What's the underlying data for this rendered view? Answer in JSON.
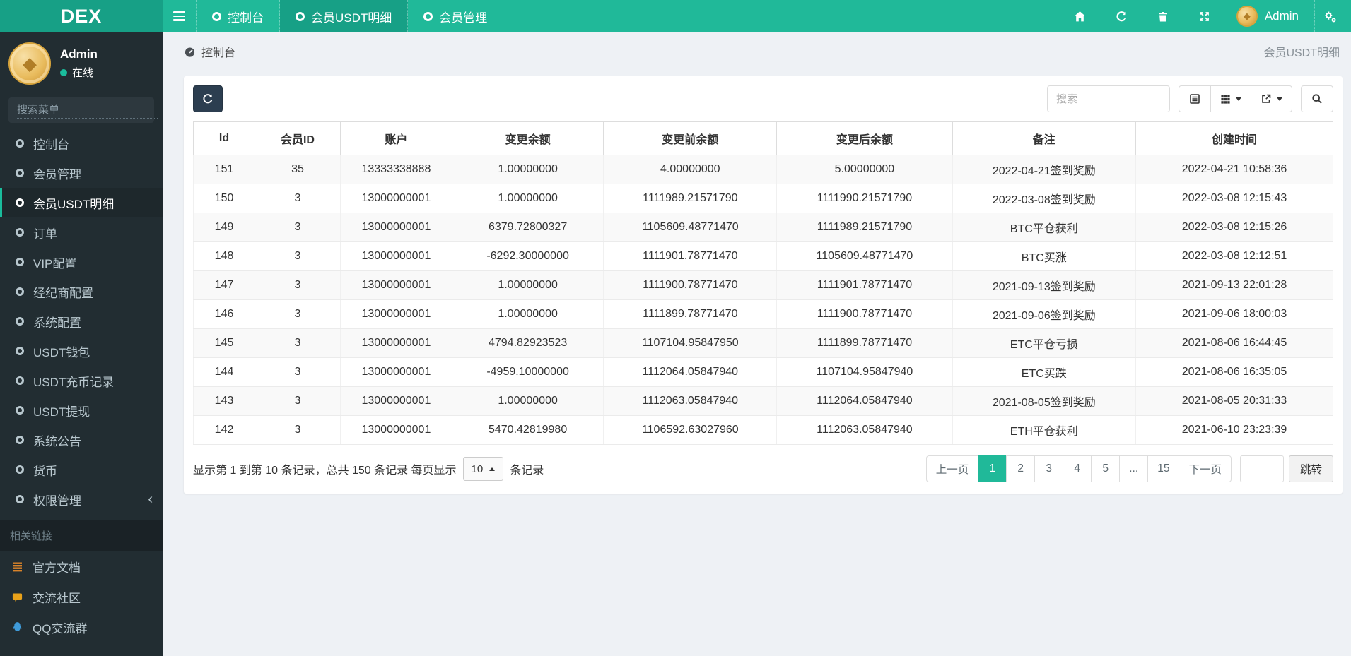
{
  "navbar": {
    "brand": "DEX",
    "tabs": [
      {
        "label": "控制台",
        "active": false
      },
      {
        "label": "会员USDT明细",
        "active": true
      },
      {
        "label": "会员管理",
        "active": false
      }
    ],
    "icon_names": [
      "menu-icon",
      "home-icon",
      "refresh-icon",
      "trash-icon",
      "fullscreen-icon",
      "gears-icon"
    ],
    "user": "Admin"
  },
  "sidebar": {
    "user": {
      "name": "Admin",
      "status": "在线"
    },
    "search_placeholder": "搜索菜单",
    "items": [
      {
        "label": "控制台",
        "active": false
      },
      {
        "label": "会员管理",
        "active": false
      },
      {
        "label": "会员USDT明细",
        "active": true
      },
      {
        "label": "订单",
        "active": false
      },
      {
        "label": "VIP配置",
        "active": false
      },
      {
        "label": "经纪商配置",
        "active": false
      },
      {
        "label": "系统配置",
        "active": false
      },
      {
        "label": "USDT钱包",
        "active": false
      },
      {
        "label": "USDT充币记录",
        "active": false
      },
      {
        "label": "USDT提现",
        "active": false
      },
      {
        "label": "系统公告",
        "active": false
      },
      {
        "label": "货币",
        "active": false
      },
      {
        "label": "权限管理",
        "active": false,
        "chevron": "‹"
      }
    ],
    "section_label": "相关链接",
    "links": [
      {
        "label": "官方文档",
        "icon": "doc-icon"
      },
      {
        "label": "交流社区",
        "icon": "comment-icon"
      },
      {
        "label": "QQ交流群",
        "icon": "qq-icon"
      }
    ]
  },
  "breadcrumb": {
    "left": "控制台",
    "right": "会员USDT明细"
  },
  "toolbar": {
    "search_placeholder": "搜索",
    "icon_names": [
      "refresh-icon",
      "detail-view-icon",
      "columns-grid-icon",
      "export-icon",
      "search-icon"
    ]
  },
  "table": {
    "columns": [
      "Id",
      "会员ID",
      "账户",
      "变更余额",
      "变更前余额",
      "变更后余额",
      "备注",
      "创建时间"
    ],
    "rows": [
      [
        "151",
        "35",
        "13333338888",
        "1.00000000",
        "4.00000000",
        "5.00000000",
        "2022-04-21签到奖励",
        "2022-04-21 10:58:36"
      ],
      [
        "150",
        "3",
        "13000000001",
        "1.00000000",
        "1111989.21571790",
        "1111990.21571790",
        "2022-03-08签到奖励",
        "2022-03-08 12:15:43"
      ],
      [
        "149",
        "3",
        "13000000001",
        "6379.72800327",
        "1105609.48771470",
        "1111989.21571790",
        "BTC平仓获利",
        "2022-03-08 12:15:26"
      ],
      [
        "148",
        "3",
        "13000000001",
        "-6292.30000000",
        "1111901.78771470",
        "1105609.48771470",
        "BTC买涨",
        "2022-03-08 12:12:51"
      ],
      [
        "147",
        "3",
        "13000000001",
        "1.00000000",
        "1111900.78771470",
        "1111901.78771470",
        "2021-09-13签到奖励",
        "2021-09-13 22:01:28"
      ],
      [
        "146",
        "3",
        "13000000001",
        "1.00000000",
        "1111899.78771470",
        "1111900.78771470",
        "2021-09-06签到奖励",
        "2021-09-06 18:00:03"
      ],
      [
        "145",
        "3",
        "13000000001",
        "4794.82923523",
        "1107104.95847950",
        "1111899.78771470",
        "ETC平仓亏损",
        "2021-08-06 16:44:45"
      ],
      [
        "144",
        "3",
        "13000000001",
        "-4959.10000000",
        "1112064.05847940",
        "1107104.95847940",
        "ETC买跌",
        "2021-08-06 16:35:05"
      ],
      [
        "143",
        "3",
        "13000000001",
        "1.00000000",
        "1112063.05847940",
        "1112064.05847940",
        "2021-08-05签到奖励",
        "2021-08-05 20:31:33"
      ],
      [
        "142",
        "3",
        "13000000001",
        "5470.42819980",
        "1106592.63027960",
        "1112063.05847940",
        "ETH平仓获利",
        "2021-06-10 23:23:39"
      ]
    ]
  },
  "pagination": {
    "summary_prefix": "显示第 1 到第 10 条记录，总共 150 条记录 每页显示",
    "page_size": "10",
    "summary_suffix": "条记录",
    "prev": "上一页",
    "next": "下一页",
    "pages": [
      "1",
      "2",
      "3",
      "4",
      "5",
      "...",
      "15"
    ],
    "active_page": "1",
    "jump_label": "跳转"
  },
  "colors": {
    "navbar": "#20b999",
    "navbar_dark": "#17a086",
    "sidebar": "#222d32",
    "sidebar_active_border": "#1abc9c",
    "refresh_button": "#2c3e50",
    "active_page": "#20b999",
    "doc_icon": "#d9832a",
    "comment_icon": "#e9a21a",
    "qq_icon": "#3f9bd9"
  }
}
